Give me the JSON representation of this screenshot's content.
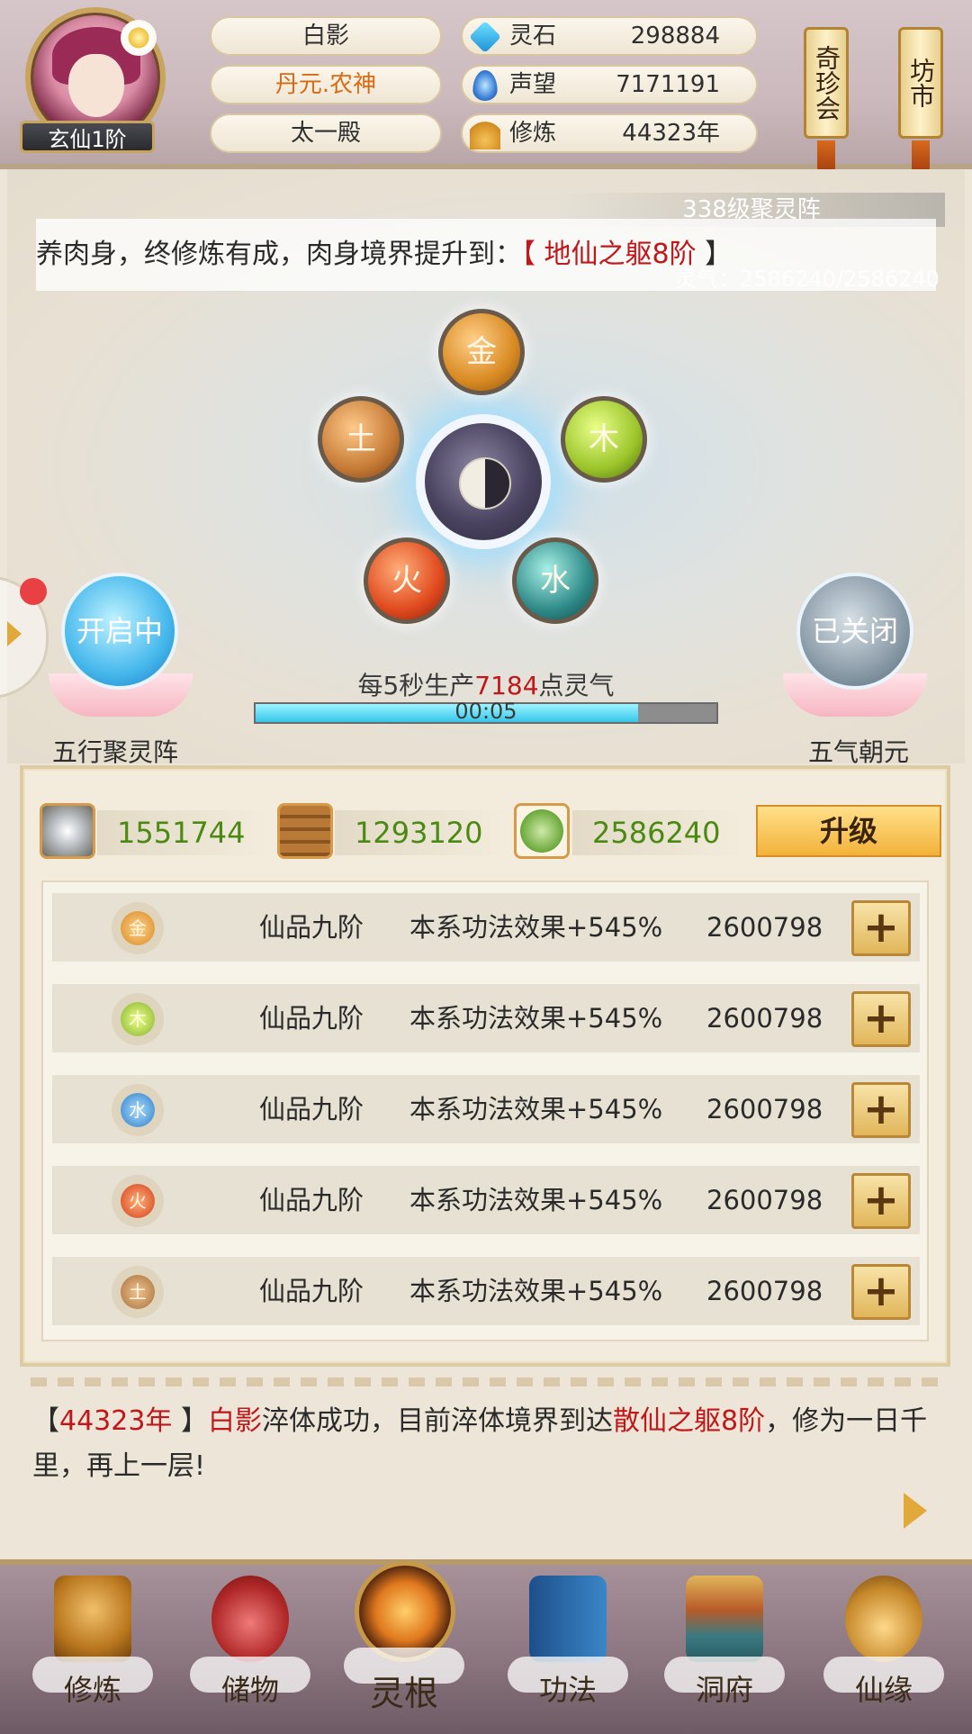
{
  "header": {
    "player_name": "白影",
    "player_title": "丹元.农神",
    "sect": "太一殿",
    "rank": "玄仙1阶",
    "stats": [
      {
        "label": "灵石",
        "value": "298884",
        "icon": "spirit-stone-icon"
      },
      {
        "label": "声望",
        "value": "7171191",
        "icon": "reputation-crystal-icon"
      },
      {
        "label": "修炼",
        "value": "44323年",
        "icon": "meditation-icon"
      }
    ],
    "scroll_buttons": {
      "treasure_auction": "奇珍会",
      "market": "坊市"
    }
  },
  "array": {
    "level_label": "338级聚灵阵",
    "notice_prefix": "养肉身，终修炼有成，肉身境界提升到：",
    "notice_open": "【 ",
    "notice_highlight": "地仙之躯8阶",
    "notice_close": " 】",
    "qi_readout": "灵气：2586240/2586240",
    "elements": {
      "metal": "金",
      "wood": "木",
      "water": "水",
      "fire": "火",
      "earth": "土"
    },
    "left_toggle": {
      "status": "开启中",
      "label": "五行聚灵阵"
    },
    "right_toggle": {
      "status": "已关闭",
      "label": "五气朝元"
    },
    "production_prefix": "每5秒生产",
    "production_value": "7184",
    "production_suffix": "点灵气",
    "timer": "00:05",
    "progress": 0.83
  },
  "resources": [
    {
      "icon": "spirit-ore-icon",
      "value": "1551744"
    },
    {
      "icon": "wood-logs-icon",
      "value": "1293120"
    },
    {
      "icon": "herb-icon",
      "value": "2586240"
    }
  ],
  "upgrade_label": "升级",
  "element_rows": [
    {
      "element": "金",
      "grade": "仙品九阶",
      "effect": "本系功法效果+545%",
      "cost": "2600798",
      "plus": "+"
    },
    {
      "element": "木",
      "grade": "仙品九阶",
      "effect": "本系功法效果+545%",
      "cost": "2600798",
      "plus": "+"
    },
    {
      "element": "水",
      "grade": "仙品九阶",
      "effect": "本系功法效果+545%",
      "cost": "2600798",
      "plus": "+"
    },
    {
      "element": "火",
      "grade": "仙品九阶",
      "effect": "本系功法效果+545%",
      "cost": "2600798",
      "plus": "+"
    },
    {
      "element": "土",
      "grade": "仙品九阶",
      "effect": "本系功法效果+545%",
      "cost": "2600798",
      "plus": "+"
    }
  ],
  "log": {
    "open_bracket": "【",
    "year": "44323年",
    "close_bracket": " 】",
    "name": "白影",
    "text_mid": "淬体成功，目前淬体境界到达",
    "realm": "散仙之躯8阶",
    "text_end": "，修为一日千里，再上一层!"
  },
  "nav": [
    {
      "label": "修炼"
    },
    {
      "label": "储物"
    },
    {
      "label": "灵根"
    },
    {
      "label": "功法"
    },
    {
      "label": "洞府"
    },
    {
      "label": "仙缘"
    }
  ],
  "colors": {
    "highlight_red": "#c0181a",
    "resource_green": "#4a8a12",
    "title_orange": "#d96a12",
    "progress_cyan": "#35c6ea"
  }
}
